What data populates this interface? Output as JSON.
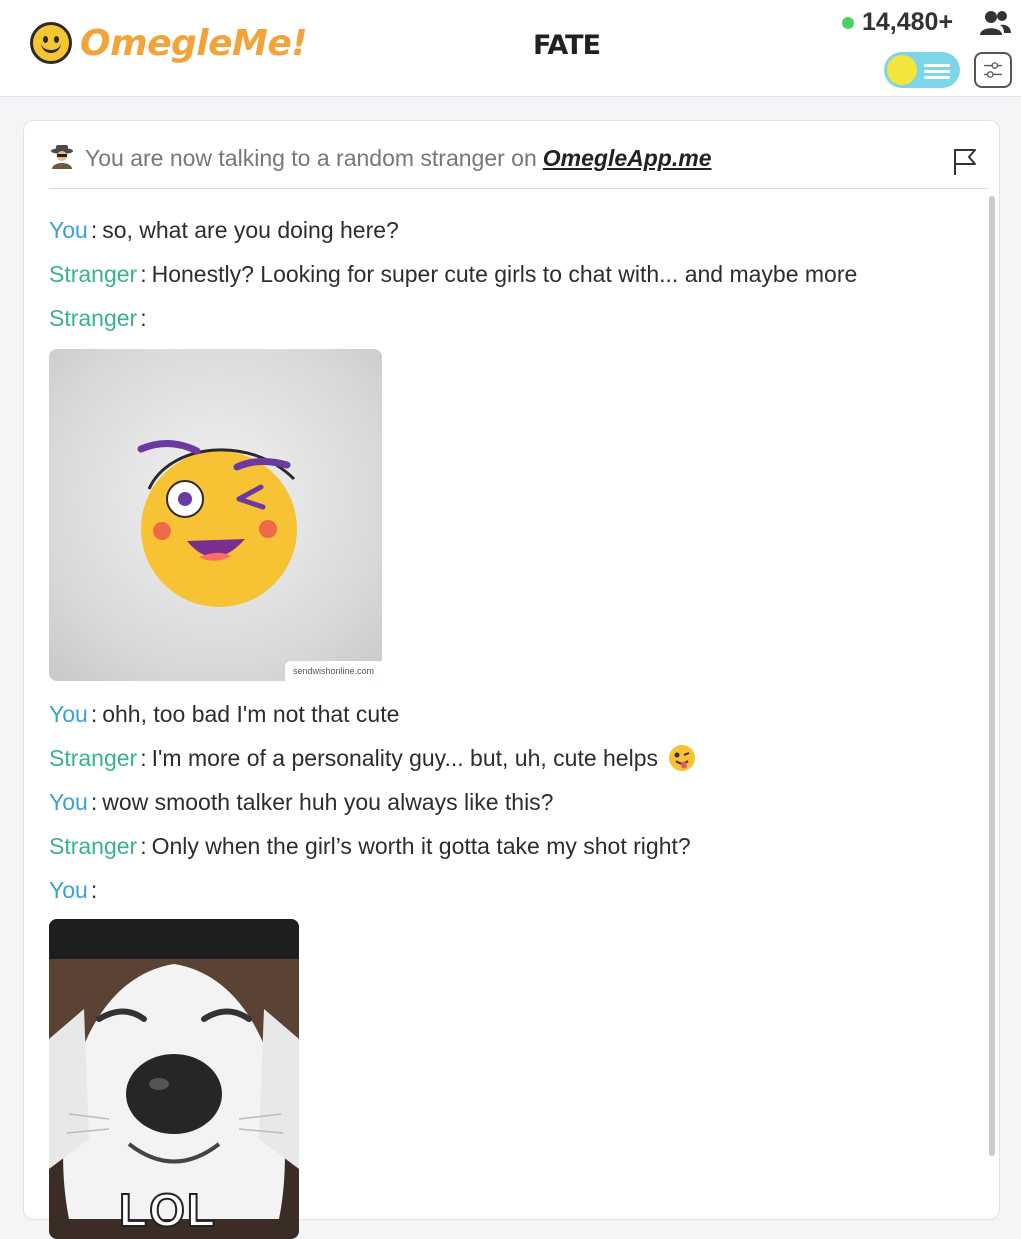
{
  "header": {
    "logo_text": "OmegleMe!",
    "center_brand": "FATE",
    "online_count": "14,480+",
    "toggle_state": "on"
  },
  "chat": {
    "intro_text": "You are now talking to a random stranger on",
    "intro_link": "OmegleApp.me",
    "messages": [
      {
        "sender": "You",
        "text": "so, what are you doing here?"
      },
      {
        "sender": "Stranger",
        "text": "Honestly? Looking for super cute girls to chat with... and maybe more"
      },
      {
        "sender": "Stranger",
        "text": ""
      },
      {
        "sender": "You",
        "text": "ohh, too bad I'm not that cute"
      },
      {
        "sender": "Stranger",
        "text": "I'm more of a personality guy... but, uh, cute helps"
      },
      {
        "sender": "You",
        "text": "wow smooth talker huh you always like this?"
      },
      {
        "sender": "Stranger",
        "text": "Only when the girl’s worth it gotta take my shot right?"
      },
      {
        "sender": "You",
        "text": ""
      }
    ],
    "image_1_watermark": "sendwishonline.com",
    "image_2_caption": "LOL"
  },
  "colors": {
    "you": "#3a9fd8",
    "stranger": "#38b48b",
    "logo": "#f2a33a",
    "online_dot": "#4cd263"
  }
}
